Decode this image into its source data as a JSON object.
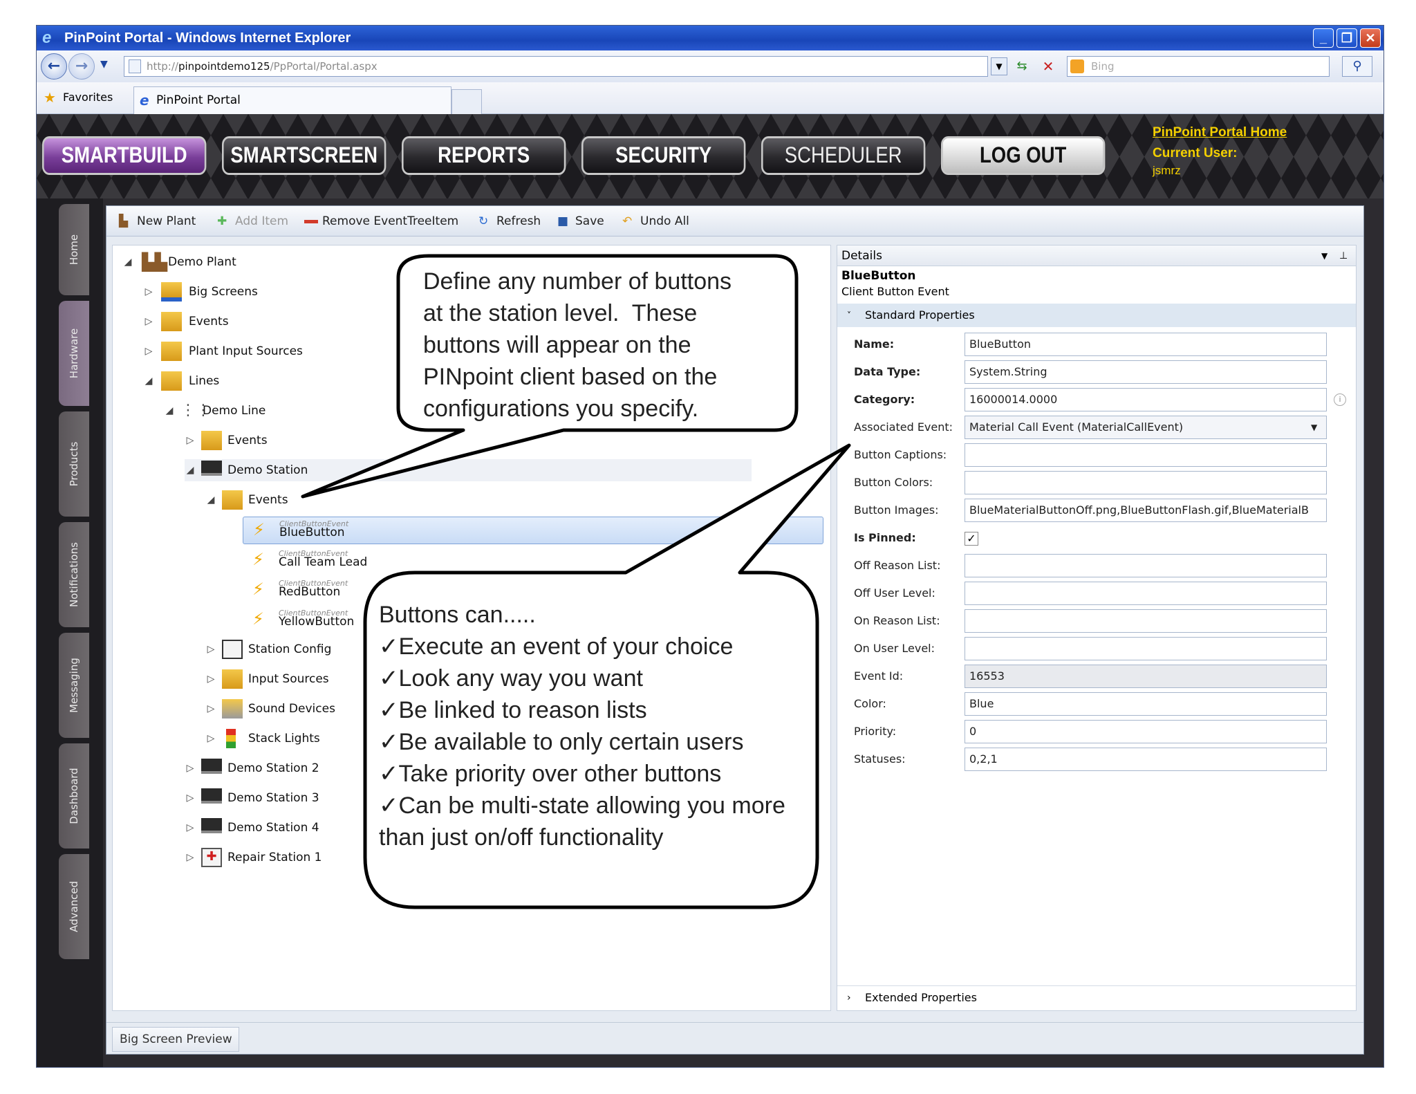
{
  "window": {
    "title": "PinPoint Portal - Windows Internet Explorer"
  },
  "address": {
    "url_prefix": "http://",
    "url_host": "pinpointdemo125",
    "url_path": "/PpPortal/Portal.aspx",
    "search_placeholder": "Bing"
  },
  "favorites": {
    "label": "Favorites",
    "tab_title": "PinPoint Portal"
  },
  "nav": {
    "smartbuild": "SMARTBUILD",
    "smartscreen": "SMARTSCREEN",
    "reports": "REPORTS",
    "security": "SECURITY",
    "scheduler": "SCHEDULER",
    "logout": "LOG OUT"
  },
  "portal_info": {
    "home_link": "PinPoint Portal Home",
    "current_user_label": "Current User:",
    "current_user": "jsmrz"
  },
  "sidetabs": [
    "Home",
    "Hardware",
    "Products",
    "Notifications",
    "Messaging",
    "Dashboard",
    "Advanced"
  ],
  "toolbar": {
    "new_plant": "New Plant",
    "add_item": "Add Item",
    "remove": "Remove EventTreeItem",
    "refresh": "Refresh",
    "save": "Save",
    "undo_all": "Undo All"
  },
  "tree": {
    "demo_plant": "Demo Plant",
    "big_screens": "Big Screens",
    "events": "Events",
    "plant_input_sources": "Plant Input Sources",
    "lines": "Lines",
    "demo_line": "Demo Line",
    "line_events": "Events",
    "demo_station": "Demo Station",
    "station_events": "Events",
    "client_button_event": "ClientButtonEvent",
    "blue_button": "BlueButton",
    "call_team_lead": "Call Team Lead",
    "red_button": "RedButton",
    "yellow_button": "YellowButton",
    "station_config": "Station Config",
    "input_sources": "Input Sources",
    "sound_devices": "Sound Devices",
    "stack_lights": "Stack Lights",
    "demo_station_2": "Demo Station 2",
    "demo_station_3": "Demo Station 3",
    "demo_station_4": "Demo Station 4",
    "repair_station_1": "Repair Station 1"
  },
  "details": {
    "header": "Details",
    "item_name": "BlueButton",
    "item_type": "Client Button Event",
    "standard_properties": "Standard Properties",
    "extended_properties": "Extended Properties",
    "props": {
      "name_label": "Name:",
      "name": "BlueButton",
      "data_type_label": "Data Type:",
      "data_type": "System.String",
      "category_label": "Category:",
      "category": "16000014.0000",
      "associated_event_label": "Associated Event:",
      "associated_event": "Material Call Event (MaterialCallEvent)",
      "button_captions_label": "Button Captions:",
      "button_captions": "",
      "button_colors_label": "Button Colors:",
      "button_colors": "",
      "button_images_label": "Button Images:",
      "button_images": "BlueMaterialButtonOff.png,BlueButtonFlash.gif,BlueMaterialB",
      "is_pinned_label": "Is Pinned:",
      "is_pinned_mark": "✓",
      "off_reason_list_label": "Off Reason List:",
      "off_reason_list": "",
      "off_user_level_label": "Off User Level:",
      "off_user_level": "",
      "on_reason_list_label": "On Reason List:",
      "on_reason_list": "",
      "on_user_level_label": "On User Level:",
      "on_user_level": "",
      "event_id_label": "Event Id:",
      "event_id": "16553",
      "color_label": "Color:",
      "color": "Blue",
      "priority_label": "Priority:",
      "priority": "0",
      "statuses_label": "Statuses:",
      "statuses": "0,2,1"
    }
  },
  "bottom": {
    "big_screen_preview": "Big Screen Preview"
  },
  "callout1": {
    "lines": [
      "Define any number of buttons",
      "at the station level.  These",
      "buttons will appear on the",
      "PINpoint client based on the",
      "configurations you specify."
    ]
  },
  "callout2": {
    "intro": "Buttons can.....",
    "check": "✓",
    "items": [
      "Execute an event of your choice",
      "Look any way you want",
      "Be linked to reason lists",
      "Be available to only certain users",
      "Take priority over other buttons",
      "Can be multi-state allowing you more"
    ],
    "tail": "than just on/off functionality"
  },
  "colors": {
    "accent_purple": "#7a3f9a",
    "portal_yellow": "#f4d000",
    "ie_blue": "#1946b8"
  }
}
